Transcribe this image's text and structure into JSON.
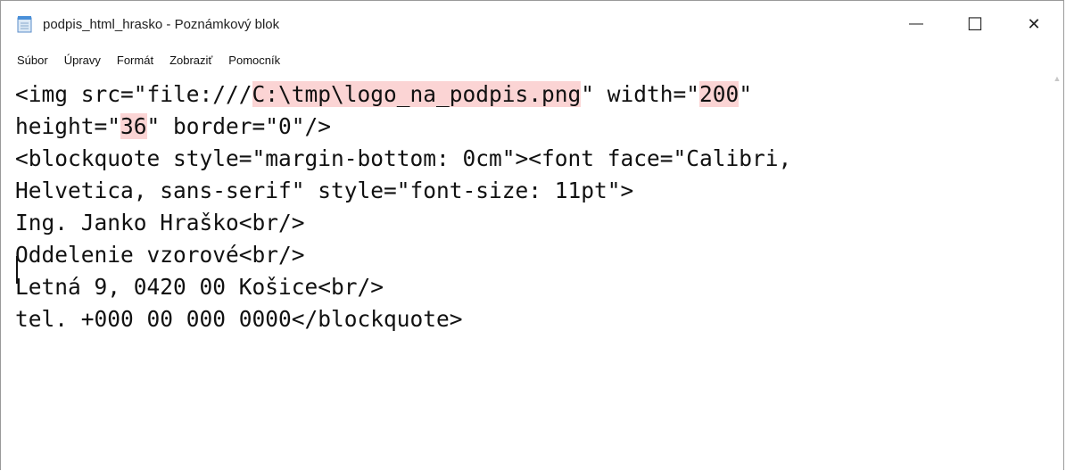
{
  "window": {
    "title": "podpis_html_hrasko - Poznámkový blok",
    "controls": {
      "minimize": "—",
      "maximize": "☐",
      "close": "✕"
    }
  },
  "menu": {
    "items": [
      "Súbor",
      "Úpravy",
      "Formát",
      "Zobraziť",
      "Pomocník"
    ]
  },
  "editor": {
    "lines": [
      [
        {
          "t": "<img src=\"file:///"
        },
        {
          "t": "C:\\tmp\\logo_na_podpis.png",
          "hl": true
        },
        {
          "t": "\" width=\""
        },
        {
          "t": "200",
          "hl": true
        },
        {
          "t": "\""
        }
      ],
      [
        {
          "t": "height=\""
        },
        {
          "t": "36",
          "hl": true
        },
        {
          "t": "\" border=\"0\"/>"
        }
      ],
      [
        {
          "t": "<blockquote style=\"margin-bottom: 0cm\"><font face=\"Calibri,"
        }
      ],
      [
        {
          "t": "Helvetica, sans-serif\" style=\"font-size: 11pt\">"
        }
      ],
      [
        {
          "t": "Ing. Janko Hraško<br/>"
        }
      ],
      [
        {
          "t": "Oddelenie vzorové<br/>"
        }
      ],
      [
        {
          "t": "Letná 9, 0420 00 Košice<br/>"
        }
      ],
      [
        {
          "t": "tel. +000 00 000 0000</blockquote>"
        }
      ]
    ]
  },
  "colors": {
    "highlight": "#fbd4d4",
    "text": "#111111"
  }
}
